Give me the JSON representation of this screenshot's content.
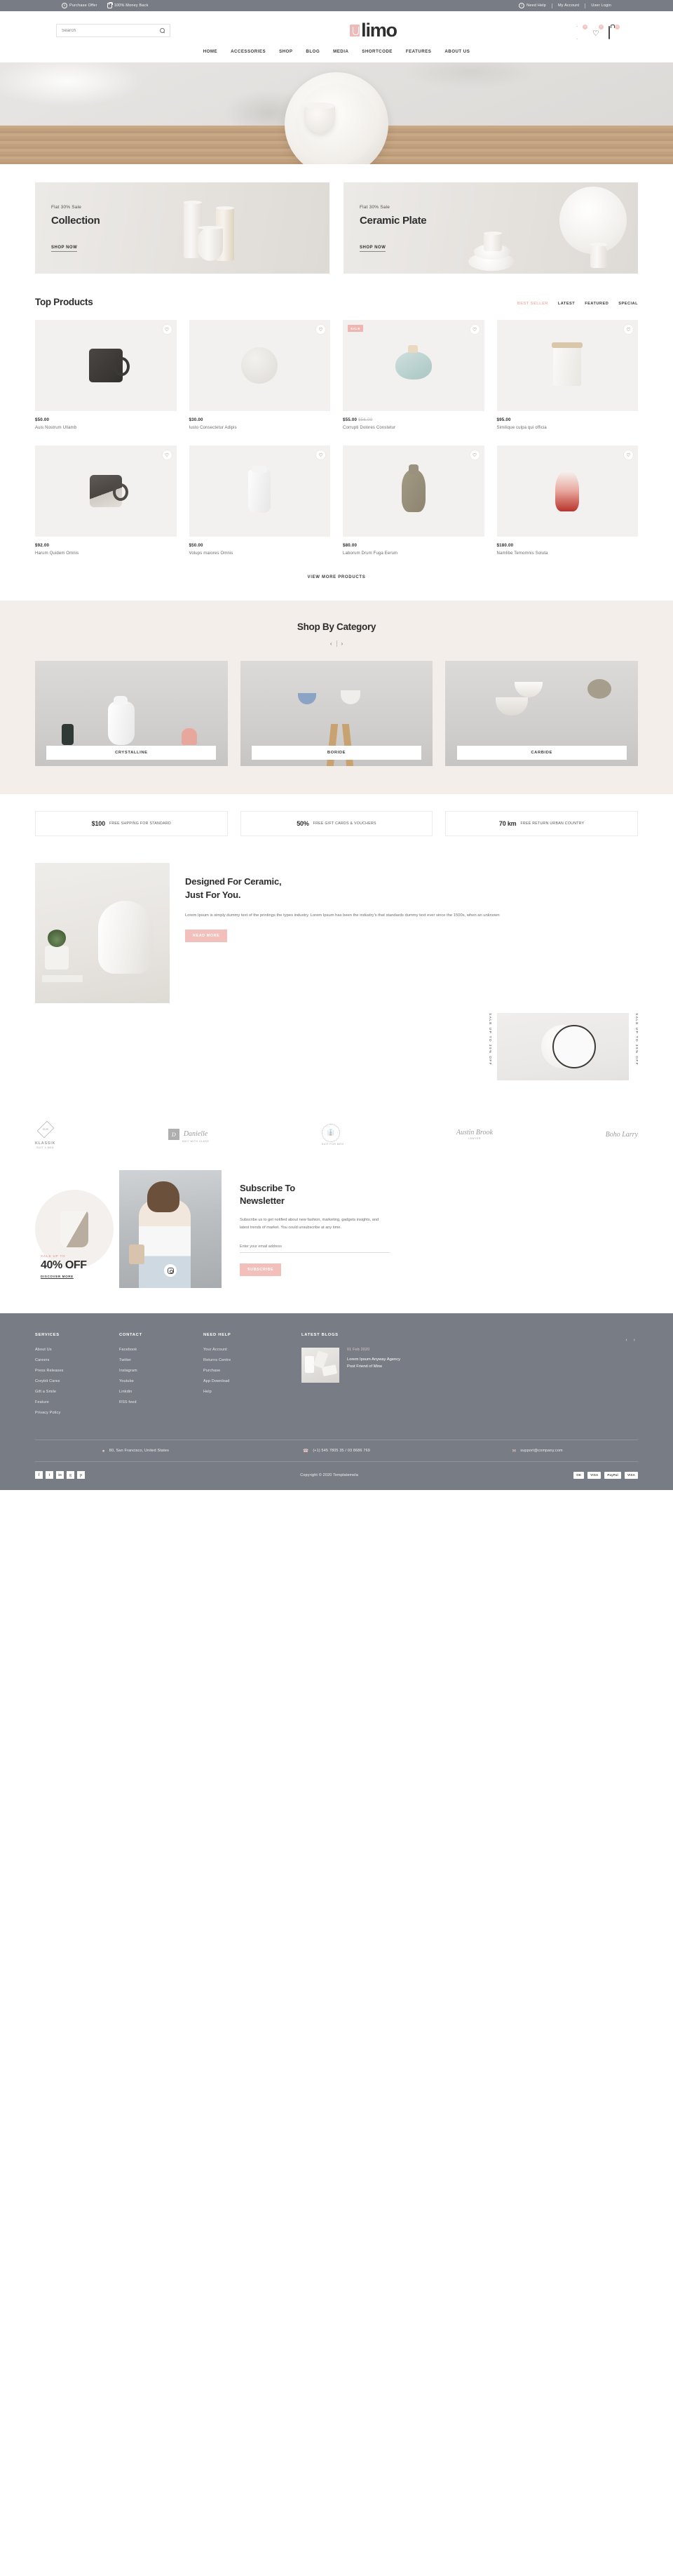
{
  "topbar": {
    "left": [
      {
        "icon": "purchase-offer-icon",
        "label": "Purchase Offer"
      },
      {
        "icon": "money-back-icon",
        "label": "100% Money Back"
      }
    ],
    "right": [
      {
        "icon": "question-icon",
        "label": "Need Help"
      },
      {
        "label": "My Account"
      },
      {
        "label": "User Login"
      }
    ]
  },
  "header": {
    "search_placeholder": "Search",
    "search_value": "",
    "logo_text": "limo",
    "compare_count": "0",
    "wishlist_count": "0",
    "cart_count": "0"
  },
  "nav": [
    {
      "label": "HOME"
    },
    {
      "label": "ACCESSORIES"
    },
    {
      "label": "SHOP"
    },
    {
      "label": "BLOG"
    },
    {
      "label": "MEDIA"
    },
    {
      "label": "SHORTCODE"
    },
    {
      "label": "FEATURES"
    },
    {
      "label": "ABOUT US"
    }
  ],
  "promos": [
    {
      "sub": "Flat 30% Sale",
      "title": "Collection",
      "cta": "SHOP NOW"
    },
    {
      "sub": "Flat 30% Sale",
      "title": "Ceramic Plate",
      "cta": "SHOP NOW"
    }
  ],
  "top_products": {
    "title": "Top Products",
    "tabs": [
      {
        "label": "BEST SELLER",
        "active": true
      },
      {
        "label": "LATEST",
        "active": false
      },
      {
        "label": "FEATURED",
        "active": false
      },
      {
        "label": "SPECIAL",
        "active": false
      }
    ],
    "view_more": "VIEW MORE PRODUCTS",
    "items": [
      {
        "price": "$50.00",
        "old_price": "",
        "name": "Auis Nostrum Ullamb",
        "badge": ""
      },
      {
        "price": "$30.00",
        "old_price": "",
        "name": "Iusto Consectetur Adipis",
        "badge": ""
      },
      {
        "price": "$55.00",
        "old_price": "$56.00",
        "name": "Corrupti Dolores Constetur",
        "badge": "SALE"
      },
      {
        "price": "$95.00",
        "old_price": "",
        "name": "Similique culpa qui officia",
        "badge": ""
      },
      {
        "price": "$92.00",
        "old_price": "",
        "name": "Harum Quidem Omnis",
        "badge": ""
      },
      {
        "price": "$50.00",
        "old_price": "",
        "name": "Volups maiores Omnis",
        "badge": ""
      },
      {
        "price": "$80.00",
        "old_price": "",
        "name": "Laborum Drum Fuga Eerum",
        "badge": ""
      },
      {
        "price": "$180.00",
        "old_price": "",
        "name": "Namlibe Temomnis Soluta",
        "badge": ""
      }
    ]
  },
  "categories": {
    "title": "Shop By Category",
    "prev": "‹",
    "next": "›",
    "items": [
      {
        "label": "CRYSTALLINE"
      },
      {
        "label": "BORIDE"
      },
      {
        "label": "CARBIDE"
      }
    ]
  },
  "services": [
    {
      "num": "$100",
      "text": "FREE SHPPING FOR STANDARD"
    },
    {
      "num": "50%",
      "text": "FREE GIFT CARDS & VOUCHERS"
    },
    {
      "num": "70 km",
      "text": "FREE RETURN URBAN COUNTRY"
    }
  ],
  "about": {
    "heading_line1": "Designed For Ceramic,",
    "heading_line2": "Just For You.",
    "paragraph": "Lorem Ipsum is simply dummy text of the printings the types industry. Lorem Ipsum has been the industry's that standards dummy text ever since the 1500s, when an unknown",
    "button": "READ MORE",
    "vertical_left": "SALE UP TO 30% OFF",
    "vertical_right": "SALE UP TO 30% OFF"
  },
  "brands": [
    {
      "name": "KLASSIK",
      "sub": "SUIT 4 MEN",
      "mark": "KL AS"
    },
    {
      "name": "Danielle",
      "sub": "SUIT WITH CLASS",
      "mark": "D"
    },
    {
      "name": "",
      "sub": "SUIT FOR MEN",
      "mark": "tie"
    },
    {
      "name": "Austin Brook",
      "sub": "LAWYER",
      "mark": ""
    },
    {
      "name": "Boho Larry",
      "sub": "",
      "mark": ""
    }
  ],
  "newsletter": {
    "badge_small": "SALE UP TO",
    "badge_big": "40% OFF",
    "badge_link": "DISCOVER MORE",
    "heading_line1": "Subscribe To",
    "heading_line2": "Newsletter",
    "paragraph": "Subscribe us to get notified about new fashion, marketing, gadgets insights, and latest trends of market. You could unsubscribe at any time.",
    "input_placeholder": "Enter your email address",
    "input_value": "",
    "button": "SUBSCRIBE",
    "instagram_icon": "instagram-icon"
  },
  "footer": {
    "columns": [
      {
        "head": "SERVICES",
        "links": [
          "About Us",
          "Careers",
          "Press Releases",
          "Creybit Cares",
          "Gift a Smile",
          "Feature",
          "Privacy Policy"
        ]
      },
      {
        "head": "CONTACT",
        "links": [
          "Facebook",
          "Twitter",
          "Instagram",
          "Youtube",
          "Linkdin",
          "RSS feed"
        ]
      },
      {
        "head": "NEED HELP",
        "links": [
          "Your Account",
          "Returns Centre",
          "Purchase",
          "App Download",
          "Help"
        ]
      }
    ],
    "blogs": {
      "head": "LATEST BLOGS",
      "prev": "‹",
      "next": "›",
      "items": [
        {
          "date": "01 Feb 2020",
          "title_line1": "Lorem Ipsum Anyway Agency",
          "title_line2": "Post Friend of Mine"
        }
      ]
    },
    "contact": [
      {
        "icon": "location-icon",
        "text": "80, San Francisco, United States"
      },
      {
        "icon": "phone-icon",
        "text": "(+1) 545 7805 35 / 03 8686 769"
      },
      {
        "icon": "mail-icon",
        "text": "support@company.com"
      }
    ],
    "socials": [
      "f",
      "t",
      "in",
      "g",
      "p"
    ],
    "copyright": "Copyright © 2020 Templatemela",
    "payments": [
      "OK",
      "VISA",
      "PayPal",
      "VISA"
    ]
  }
}
